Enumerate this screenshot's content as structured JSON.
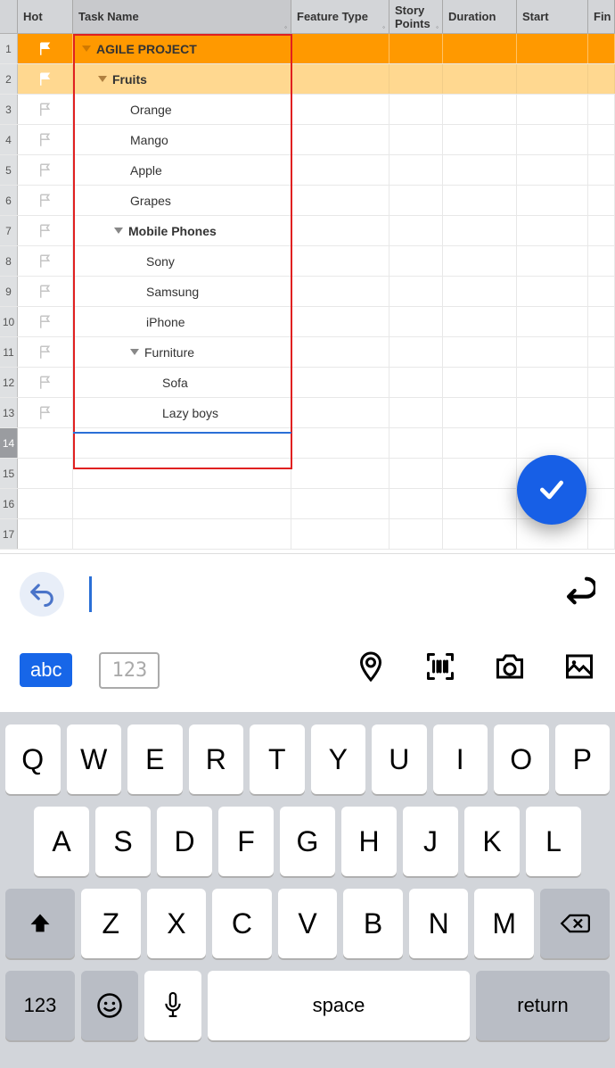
{
  "columns": {
    "hot": "Hot",
    "taskName": "Task Name",
    "featureType": "Feature Type",
    "storyPoints": "Story Points",
    "duration": "Duration",
    "start": "Start",
    "finish": "Fin"
  },
  "rows": [
    {
      "num": "1",
      "indent": 0,
      "expand": true,
      "bold": true,
      "style": "dark",
      "flag": "white",
      "label": "AGILE PROJECT"
    },
    {
      "num": "2",
      "indent": 1,
      "expand": true,
      "bold": true,
      "style": "light",
      "flag": "white",
      "label": "Fruits"
    },
    {
      "num": "3",
      "indent": 3,
      "expand": false,
      "bold": false,
      "style": "",
      "flag": "gray",
      "label": "Orange"
    },
    {
      "num": "4",
      "indent": 3,
      "expand": false,
      "bold": false,
      "style": "",
      "flag": "gray",
      "label": "Mango"
    },
    {
      "num": "5",
      "indent": 3,
      "expand": false,
      "bold": false,
      "style": "",
      "flag": "gray",
      "label": "Apple"
    },
    {
      "num": "6",
      "indent": 3,
      "expand": false,
      "bold": false,
      "style": "",
      "flag": "gray",
      "label": "Grapes"
    },
    {
      "num": "7",
      "indent": 2,
      "expand": true,
      "bold": true,
      "style": "",
      "flag": "gray",
      "label": "Mobile Phones"
    },
    {
      "num": "8",
      "indent": 4,
      "expand": false,
      "bold": false,
      "style": "",
      "flag": "gray",
      "label": "Sony"
    },
    {
      "num": "9",
      "indent": 4,
      "expand": false,
      "bold": false,
      "style": "",
      "flag": "gray",
      "label": "Samsung"
    },
    {
      "num": "10",
      "indent": 4,
      "expand": false,
      "bold": false,
      "style": "",
      "flag": "gray",
      "label": "iPhone"
    },
    {
      "num": "11",
      "indent": 3,
      "expand": true,
      "bold": false,
      "style": "",
      "flag": "gray",
      "label": "Furniture"
    },
    {
      "num": "12",
      "indent": 5,
      "expand": false,
      "bold": false,
      "style": "",
      "flag": "gray",
      "label": "Sofa"
    },
    {
      "num": "13",
      "indent": 5,
      "expand": false,
      "bold": false,
      "style": "",
      "flag": "gray",
      "label": "Lazy boys"
    },
    {
      "num": "14",
      "indent": 0,
      "expand": false,
      "bold": false,
      "style": "",
      "flag": "",
      "label": "",
      "active": true
    },
    {
      "num": "15",
      "indent": 0,
      "expand": false,
      "bold": false,
      "style": "",
      "flag": "",
      "label": ""
    },
    {
      "num": "16",
      "indent": 0,
      "expand": false,
      "bold": false,
      "style": "",
      "flag": "",
      "label": ""
    },
    {
      "num": "17",
      "indent": 0,
      "expand": false,
      "bold": false,
      "style": "",
      "flag": "",
      "label": ""
    }
  ],
  "inputBar": {
    "abc": "abc",
    "num123": "123"
  },
  "keyboard": {
    "row1": [
      "Q",
      "W",
      "E",
      "R",
      "T",
      "Y",
      "U",
      "I",
      "O",
      "P"
    ],
    "row2": [
      "A",
      "S",
      "D",
      "F",
      "G",
      "H",
      "J",
      "K",
      "L"
    ],
    "row3": [
      "Z",
      "X",
      "C",
      "V",
      "B",
      "N",
      "M"
    ],
    "numKey": "123",
    "spaceKey": "space",
    "returnKey": "return"
  }
}
